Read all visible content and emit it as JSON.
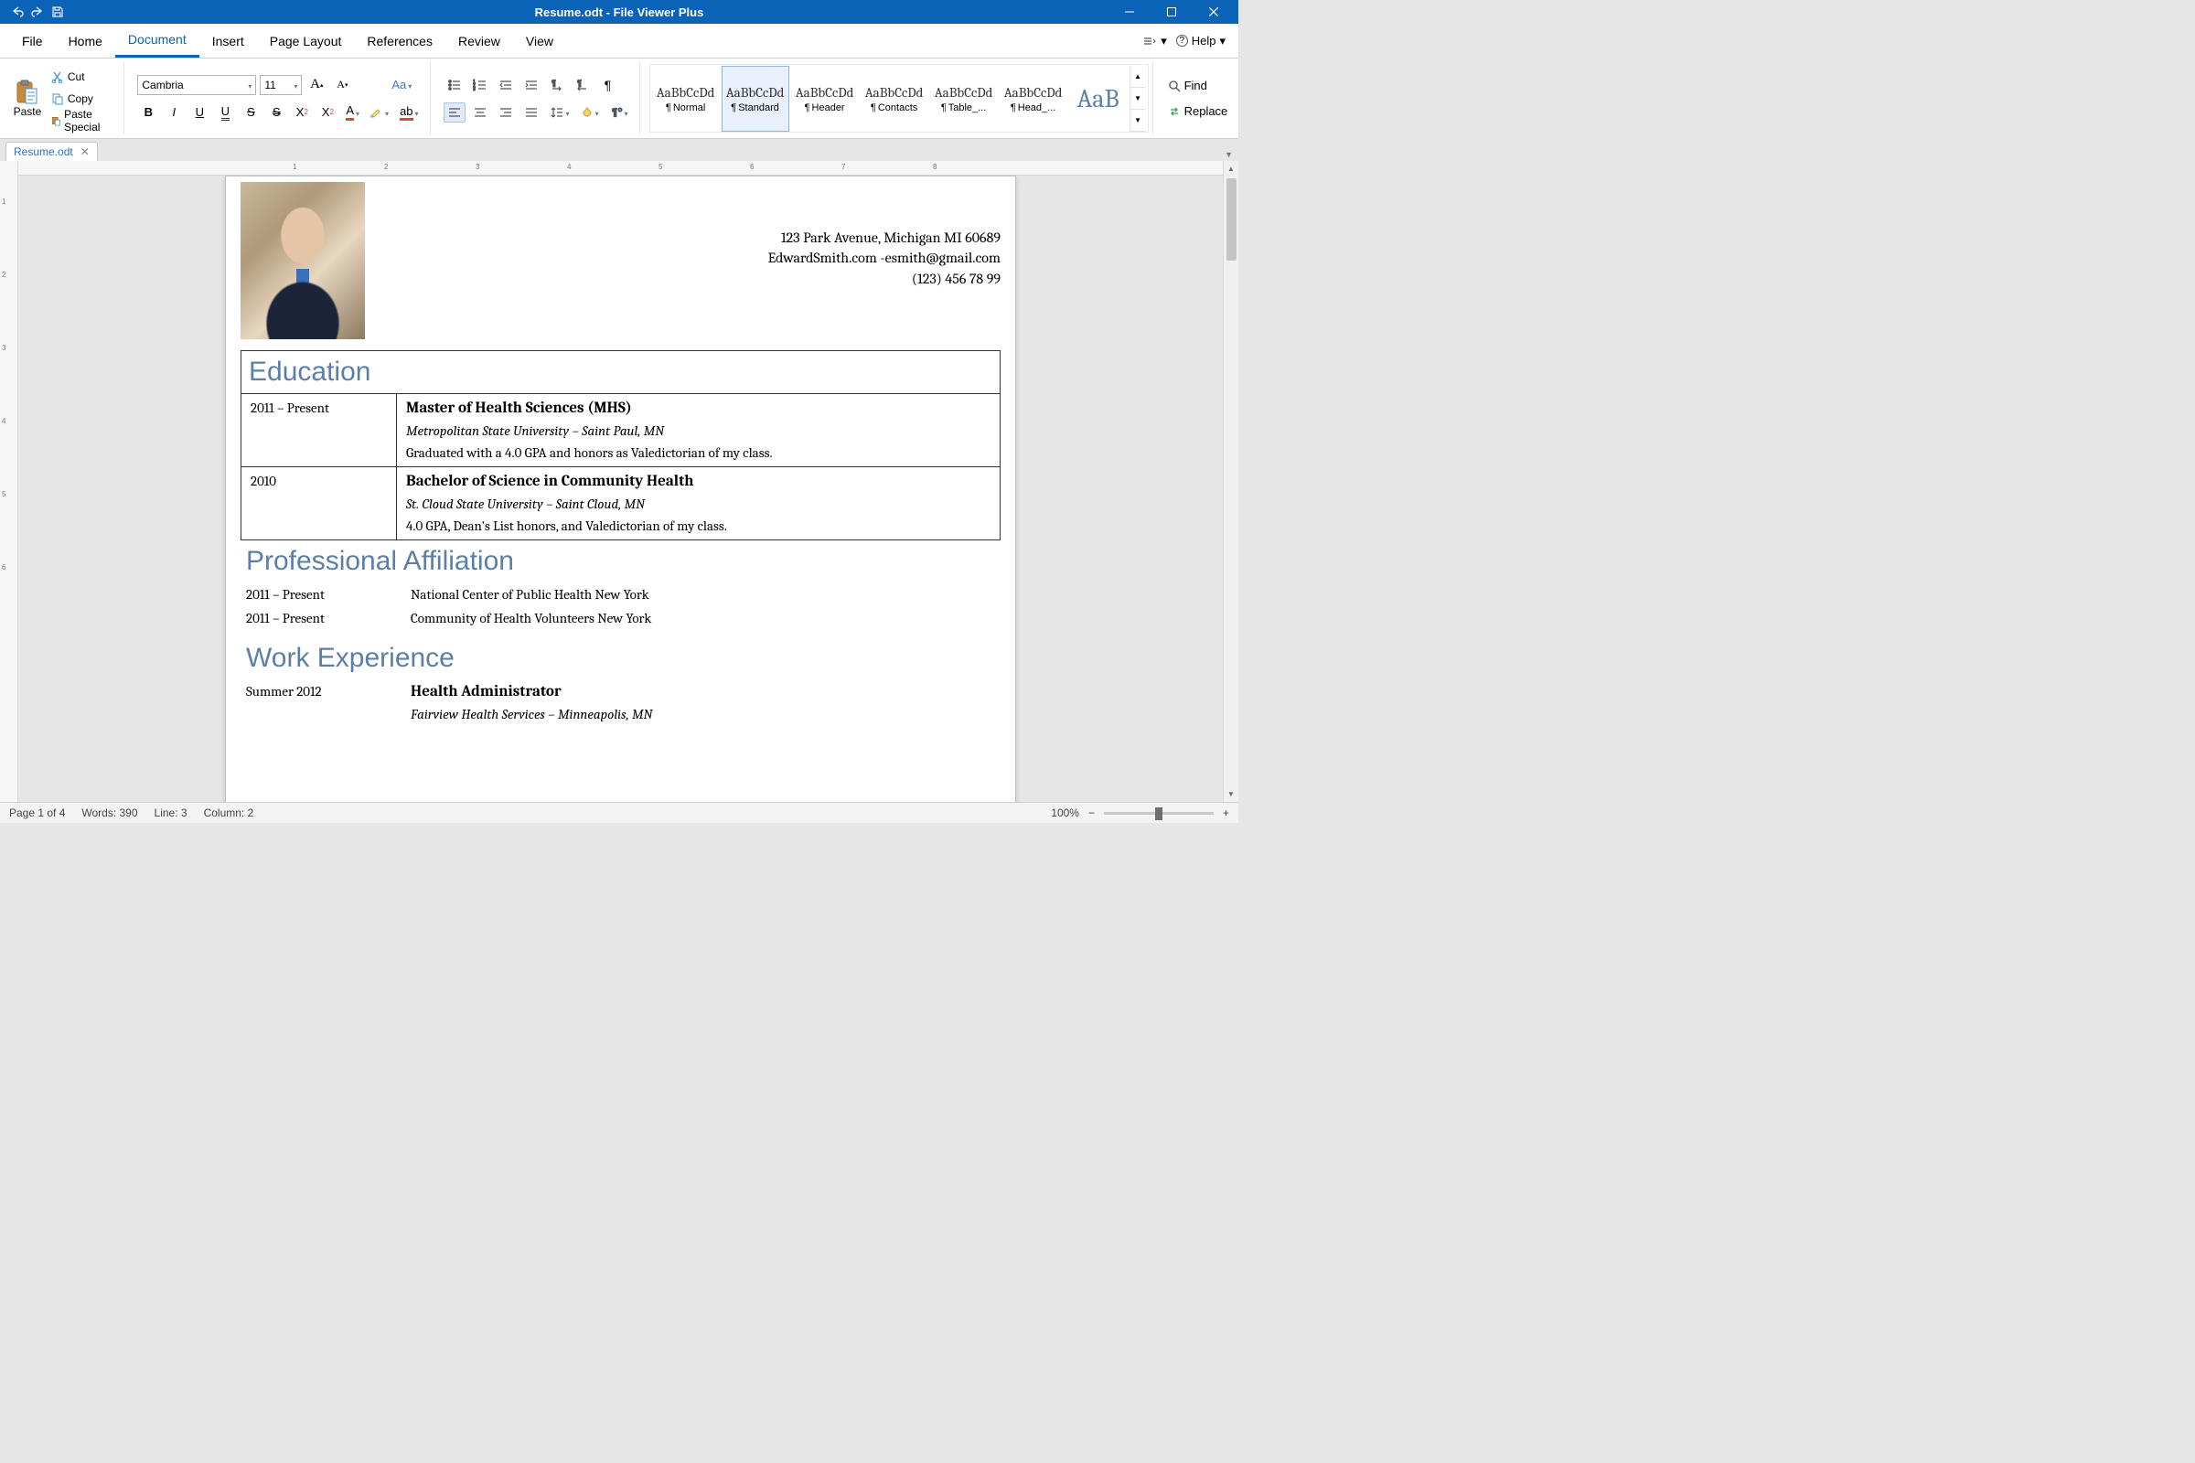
{
  "titlebar": {
    "title": "Resume.odt - File Viewer Plus"
  },
  "menu": {
    "items": [
      "File",
      "Home",
      "Document",
      "Insert",
      "Page Layout",
      "References",
      "Review",
      "View"
    ],
    "active": 2,
    "options": "⚙",
    "help": "Help"
  },
  "clipboard": {
    "paste": "Paste",
    "cut": "Cut",
    "copy": "Copy",
    "paste_special": "Paste Special"
  },
  "font": {
    "name": "Cambria",
    "size": "11",
    "change_case": "Aa"
  },
  "styles": [
    {
      "preview": "AaBbCcDd",
      "label": "Normal"
    },
    {
      "preview": "AaBbCcDd",
      "label": "Standard",
      "selected": true
    },
    {
      "preview": "AaBbCcDd",
      "label": "Header"
    },
    {
      "preview": "AaBbCcDd",
      "label": "Contacts"
    },
    {
      "preview": "AaBbCcDd",
      "label": "Table_..."
    },
    {
      "preview": "AaBbCcDd",
      "label": "Head_..."
    },
    {
      "preview": "AaB",
      "label": "",
      "big": true
    }
  ],
  "editing": {
    "find": "Find",
    "replace": "Replace"
  },
  "tab": {
    "name": "Resume.odt"
  },
  "doc": {
    "contact": {
      "line1": "123 Park Avenue, Michigan MI 60689",
      "line2": "EdwardSmith.com -esmith@gmail.com",
      "line3": "(123) 456 78 99"
    },
    "education_heading": "Education",
    "edu": [
      {
        "dates": "2011 – Present",
        "degree": "Master of Health Sciences (MHS)",
        "school": "Metropolitan State University – Saint Paul, MN",
        "detail": "Graduated with a 4.0 GPA and honors as Valedictorian of my class."
      },
      {
        "dates": "2010",
        "degree": "Bachelor of Science in Community Health",
        "school": "St. Cloud State University – Saint Cloud, MN",
        "detail": "4.0 GPA, Dean's List honors, and Valedictorian of my class."
      }
    ],
    "prof_heading": "Professional Affiliation",
    "aff": [
      {
        "dates": "2011 – Present",
        "org": "National Center of Public Health New York"
      },
      {
        "dates": "2011 – Present",
        "org": "Community of Health Volunteers New York"
      }
    ],
    "work_heading": "Work Experience",
    "work": [
      {
        "dates": "Summer 2012",
        "title": "Health Administrator",
        "company": "Fairview Health Services – Minneapolis, MN"
      }
    ]
  },
  "status": {
    "page": "Page 1 of 4",
    "words": "Words: 390",
    "line": "Line: 3",
    "column": "Column: 2",
    "zoom": "100%"
  }
}
